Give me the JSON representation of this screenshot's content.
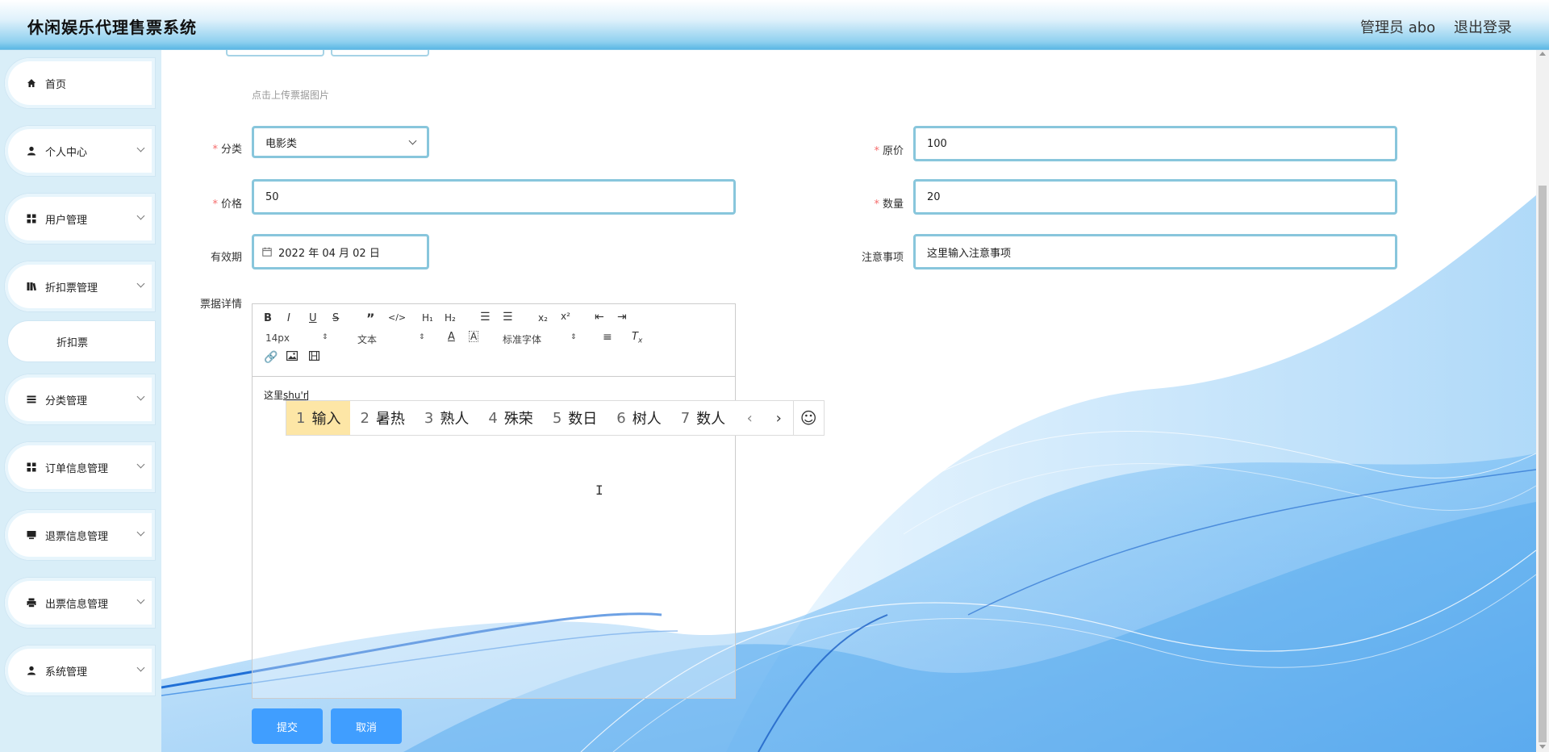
{
  "header": {
    "app_title": "休闲娱乐代理售票系统",
    "admin_label": "管理员 abo",
    "logout_label": "退出登录"
  },
  "sidebar": {
    "items": [
      {
        "label": "首页",
        "icon": "home-icon",
        "expandable": false
      },
      {
        "label": "个人中心",
        "icon": "user-icon",
        "expandable": true
      },
      {
        "label": "用户管理",
        "icon": "grid-icon",
        "expandable": true
      },
      {
        "label": "折扣票管理",
        "icon": "book-icon",
        "expandable": true
      },
      {
        "label": "分类管理",
        "icon": "list-icon",
        "expandable": true
      },
      {
        "label": "订单信息管理",
        "icon": "grid-icon",
        "expandable": true
      },
      {
        "label": "退票信息管理",
        "icon": "monitor-icon",
        "expandable": true
      },
      {
        "label": "出票信息管理",
        "icon": "printer-icon",
        "expandable": true
      },
      {
        "label": "系统管理",
        "icon": "user-settings-icon",
        "expandable": true
      }
    ],
    "sub_item": "折扣票"
  },
  "form": {
    "upload_hint": "点击上传票据图片",
    "category": {
      "label": "分类",
      "value": "电影类"
    },
    "original_price": {
      "label": "原价",
      "value": "100"
    },
    "price": {
      "label": "价格",
      "value": "50"
    },
    "quantity": {
      "label": "数量",
      "value": "20"
    },
    "validity": {
      "label": "有效期",
      "value": "2022 年 04 月 02 日"
    },
    "notes": {
      "label": "注意事项",
      "value": "这里输入注意事项"
    },
    "details": {
      "label": "票据详情"
    }
  },
  "editor": {
    "font_size": "14px",
    "text_type": "文本",
    "font_family": "标准字体",
    "content_prefix": "这里",
    "content_composing": "shu'r"
  },
  "ime": {
    "candidates": [
      {
        "num": "1",
        "text": "输入"
      },
      {
        "num": "2",
        "text": "暑热"
      },
      {
        "num": "3",
        "text": "熟人"
      },
      {
        "num": "4",
        "text": "殊荣"
      },
      {
        "num": "5",
        "text": "数日"
      },
      {
        "num": "6",
        "text": "树人"
      },
      {
        "num": "7",
        "text": "数人"
      }
    ]
  },
  "buttons": {
    "submit": "提交",
    "cancel": "取消"
  },
  "colors": {
    "primary": "#409eff",
    "field_border": "#88c6dc",
    "required": "#f56c6c",
    "ime_highlight": "#fde6a6"
  }
}
